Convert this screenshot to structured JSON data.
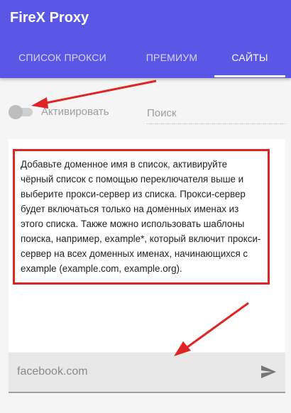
{
  "header": {
    "title": "FireX Proxy",
    "tabs": [
      {
        "label": "СПИСОК ПРОКСИ",
        "active": false
      },
      {
        "label": "ПРЕМИУМ",
        "active": false
      },
      {
        "label": "САЙТЫ",
        "active": true
      }
    ]
  },
  "controls": {
    "toggle_label": "Активировать",
    "toggle_on": false,
    "search_placeholder": "Поиск"
  },
  "info": {
    "text": "Добавьте доменное имя в список, активируйте чёрный список с помощью переключателя выше и выберите прокси-сервер из списка. Прокси-сервер будет включаться только на доменных именах из этого списка. Также можно использовать шаблоны поиска, например, example*, который включит прокси-сервер на всех доменных именах, начинающихся с example (example.com, example.org)."
  },
  "domain": {
    "placeholder": "facebook.com"
  },
  "colors": {
    "header": "#5b57e6",
    "annotation": "#e02424"
  },
  "icons": {
    "send": "send-icon",
    "toggle": "toggle-switch"
  }
}
